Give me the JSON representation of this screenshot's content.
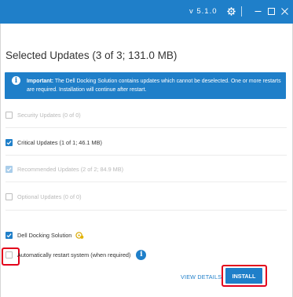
{
  "window": {
    "version": "v 5.1.0",
    "icons": {
      "settings": "gear-icon",
      "minimize": "minimize-icon",
      "maximize": "maximize-icon",
      "close": "close-icon"
    }
  },
  "heading": "Selected Updates (3 of 3; 131.0 MB)",
  "banner": {
    "icon": "info-icon",
    "bold": "Important:",
    "text": " The Dell Docking Solution contains updates which cannot be deselected. One or more restarts are required. Installation will continue after restart."
  },
  "categories": [
    {
      "label": "Security Updates (0 of 0)",
      "checked": false,
      "enabled": false
    },
    {
      "label": "Critical Updates (1 of 1; 46.1 MB)",
      "checked": true,
      "enabled": true
    },
    {
      "label": "Recommended Updates (2 of 2; 84.9 MB)",
      "checked": true,
      "enabled": false
    },
    {
      "label": "Optional Updates (0 of 0)",
      "checked": false,
      "enabled": false
    }
  ],
  "dock": {
    "label": "Dell Docking Solution",
    "checked": true,
    "icon": "dock-badge-icon"
  },
  "restart": {
    "label": "Automatically restart system (when required)",
    "checked": false,
    "icon": "info-icon"
  },
  "actions": {
    "view_details": "VIEW DETAILS",
    "install": "INSTALL"
  },
  "colors": {
    "accent": "#1f7fc9",
    "highlight": "#e3001b"
  }
}
